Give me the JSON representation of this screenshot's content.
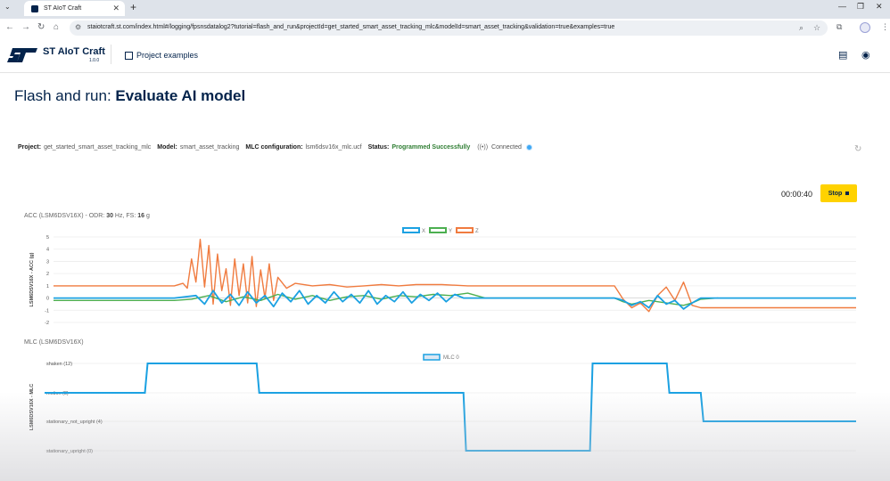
{
  "browser": {
    "tab_title": "ST AIoT Craft",
    "url": "staiotcraft.st.com/index.html#/logging/fpsnsdatalog2?tutorial=flash_and_run&projectId=get_started_smart_asset_tracking_mlc&modelId=smart_asset_tracking&validation=true&examples=true"
  },
  "app": {
    "brand": "ST AIoT Craft",
    "version": "1.0.0",
    "nav_label": "Project examples"
  },
  "page": {
    "title_prefix": "Flash and run: ",
    "title_main": "Evaluate AI model"
  },
  "info": {
    "project_label": "Project:",
    "project_value": "get_started_smart_asset_tracking_mlc",
    "model_label": "Model:",
    "model_value": "smart_asset_tracking",
    "mlc_label": "MLC configuration:",
    "mlc_value": "lsm6dsv16x_mlc.ucf",
    "status_label": "Status:",
    "status_value": "Programmed Successfully",
    "connection": "Connected"
  },
  "controls": {
    "timer": "00:00:40",
    "stop_label": "Stop"
  },
  "colors": {
    "accent_yellow": "#ffd200",
    "brand_navy": "#03234b",
    "series_x": "#1ba1e2",
    "series_y": "#4caf50",
    "series_z": "#f07b3f",
    "status_ok": "#2e7d32"
  },
  "chart_data": [
    {
      "type": "line",
      "title_pre": "ACC (LSM6DSV16X) - ODR: ",
      "odr": "30",
      "title_mid": " Hz, FS: ",
      "fs": "16",
      "title_unit": " g",
      "ylabel": "LSM6DSV16X - ACC (g)",
      "ylim": [
        -2,
        5
      ],
      "yticks": [
        "5",
        "4",
        "3",
        "2",
        "1",
        "0",
        "-1",
        "-2"
      ],
      "legend": [
        "X",
        "Y",
        "Z"
      ],
      "series": [
        {
          "name": "X",
          "x": [
            0,
            140,
            165,
            175,
            185,
            195,
            205,
            215,
            225,
            235,
            245,
            255,
            265,
            275,
            285,
            295,
            305,
            315,
            325,
            335,
            345,
            355,
            365,
            375,
            385,
            395,
            405,
            415,
            425,
            435,
            445,
            455,
            465,
            475,
            480,
            490,
            500,
            600,
            650,
            660,
            670,
            680,
            690,
            700,
            710,
            720,
            730,
            740,
            750,
            930
          ],
          "y": [
            0,
            0,
            0.2,
            -0.5,
            0.6,
            -0.4,
            0.3,
            -0.6,
            0.5,
            -0.4,
            0.2,
            -0.7,
            0.4,
            -0.3,
            0.6,
            -0.5,
            0.2,
            -0.4,
            0.5,
            -0.3,
            0.3,
            -0.4,
            0.6,
            -0.5,
            0.2,
            -0.3,
            0.5,
            -0.4,
            0.3,
            -0.2,
            0.4,
            -0.3,
            0.3,
            0,
            0,
            0,
            0,
            0,
            0,
            -0.2,
            -0.6,
            -0.3,
            -0.8,
            0.2,
            -0.5,
            -0.2,
            -0.9,
            -0.4,
            0,
            0
          ]
        },
        {
          "name": "Y",
          "x": [
            0,
            140,
            160,
            180,
            200,
            220,
            240,
            260,
            280,
            300,
            320,
            340,
            360,
            380,
            400,
            420,
            440,
            460,
            480,
            500,
            600,
            650,
            660,
            670,
            690,
            710,
            730,
            740,
            750,
            770
          ],
          "y": [
            -0.2,
            -0.2,
            -0.1,
            0.2,
            -0.3,
            0.1,
            -0.2,
            0.3,
            -0.1,
            0.2,
            -0.2,
            0.1,
            0.2,
            -0.1,
            0.2,
            0.1,
            0.3,
            0.2,
            0.4,
            0,
            0,
            0,
            -0.3,
            -0.5,
            -0.2,
            -0.4,
            -0.6,
            -0.4,
            -0.1,
            0
          ]
        },
        {
          "name": "Z",
          "x": [
            0,
            140,
            150,
            155,
            160,
            165,
            170,
            175,
            180,
            185,
            190,
            195,
            200,
            205,
            210,
            215,
            220,
            225,
            230,
            235,
            240,
            245,
            250,
            255,
            260,
            270,
            280,
            300,
            320,
            340,
            360,
            380,
            400,
            420,
            450,
            480,
            500,
            530,
            600,
            650,
            660,
            670,
            680,
            690,
            700,
            710,
            720,
            730,
            740,
            750,
            930
          ],
          "y": [
            1,
            1,
            1.2,
            0.8,
            3.2,
            1.3,
            4.8,
            0.9,
            4.3,
            -0.5,
            3.6,
            0.6,
            2.4,
            -0.6,
            3.2,
            0.2,
            2.8,
            -0.4,
            3.4,
            -0.7,
            2.3,
            0,
            2.8,
            -0.2,
            1.7,
            0.8,
            1.2,
            1,
            1.1,
            0.9,
            1,
            1.1,
            1,
            1.1,
            1.1,
            1,
            1,
            1,
            1,
            1,
            -0.1,
            -0.8,
            -0.4,
            -1.1,
            0.2,
            0.9,
            -0.2,
            1.3,
            -0.6,
            -0.8,
            -0.8
          ]
        }
      ]
    },
    {
      "type": "line",
      "title": "MLC (LSM6DSV16X)",
      "ylabel": "LSM6DSV16X - MLC",
      "categories": [
        "shaken (12)",
        "motion (8)",
        "stationary_not_upright (4)",
        "stationary_upright (0)"
      ],
      "legend": [
        "MLC 0"
      ],
      "series": [
        {
          "name": "MLC 0",
          "x": [
            0,
            115,
            118,
            243,
            246,
            480,
            483,
            625,
            628,
            713,
            716,
            752,
            755,
            930
          ],
          "y": [
            8,
            8,
            12,
            12,
            8,
            8,
            0,
            0,
            12,
            12,
            8,
            8,
            4,
            4
          ]
        }
      ]
    }
  ]
}
